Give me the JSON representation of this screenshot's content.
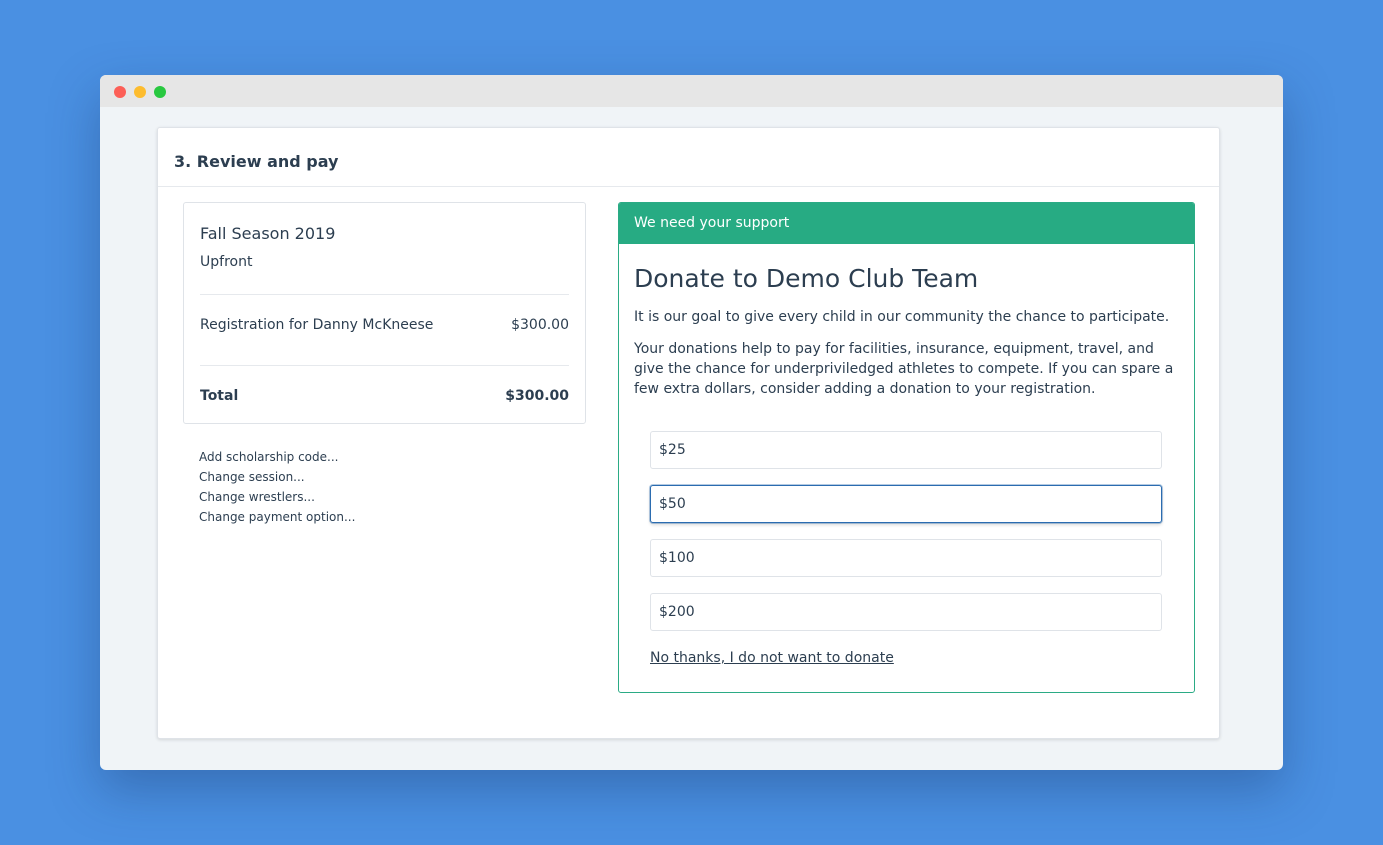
{
  "page": {
    "section_title": "3. Review and pay"
  },
  "summary": {
    "season": "Fall Season 2019",
    "payment_option": "Upfront",
    "line_item": {
      "label": "Registration for Danny McKneese",
      "amount": "$300.00"
    },
    "total": {
      "label": "Total",
      "amount": "$300.00"
    }
  },
  "links": [
    {
      "label": "Add scholarship code..."
    },
    {
      "label": "Change session..."
    },
    {
      "label": "Change wrestlers..."
    },
    {
      "label": "Change payment option..."
    }
  ],
  "donation": {
    "header": "We need your support",
    "title": "Donate to Demo Club Team",
    "paragraph1": "It is our goal to give every child in our community the chance to participate.",
    "paragraph2": "Your donations help to pay for facilities, insurance, equipment, travel, and give the chance for underpriviledged athletes to compete. If you can spare a few extra dollars, consider adding a donation to your registration.",
    "amounts": [
      {
        "label": "$25",
        "selected": false
      },
      {
        "label": "$50",
        "selected": true
      },
      {
        "label": "$100",
        "selected": false
      },
      {
        "label": "$200",
        "selected": false
      }
    ],
    "decline": "No thanks, I do not want to donate"
  },
  "colors": {
    "background": "#4a90e2",
    "accent_green": "#27ab83",
    "text": "#2c3e50",
    "selected_border": "#2b6cb0"
  }
}
